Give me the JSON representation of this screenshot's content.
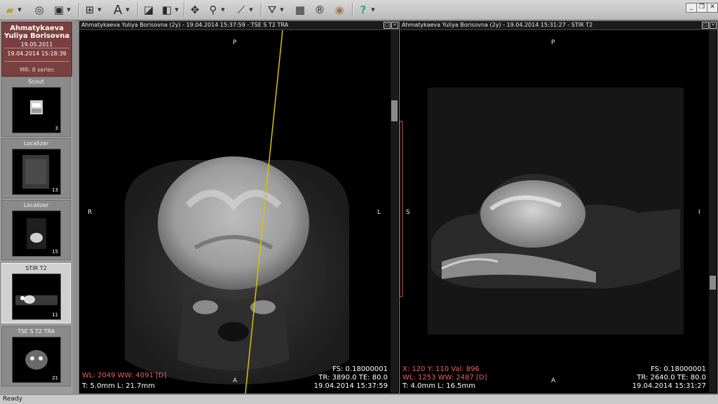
{
  "toolbar": {
    "groups": [
      {
        "icon": "folder-open-icon",
        "glyph": "📂"
      },
      {
        "icon": "cd-disc-icon",
        "glyph": "◎"
      },
      {
        "icon": "save-disk-icon",
        "glyph": "▣"
      },
      {
        "icon": "layout-grid-icon",
        "glyph": "⊞"
      },
      {
        "icon": "text-annotation-icon",
        "glyph": "A"
      },
      {
        "icon": "eraser-icon",
        "glyph": "◪"
      },
      {
        "icon": "window-level-icon",
        "glyph": "◧"
      },
      {
        "icon": "pan-move-icon",
        "glyph": "✥"
      },
      {
        "icon": "zoom-magnifier-icon",
        "glyph": "⚲"
      },
      {
        "icon": "measure-ruler-icon",
        "glyph": "⟋"
      },
      {
        "icon": "crosshair-3d-icon",
        "glyph": "⛛"
      },
      {
        "icon": "film-icon",
        "glyph": "▦"
      },
      {
        "icon": "render-r-icon",
        "glyph": "®"
      },
      {
        "icon": "badge-icon",
        "glyph": "◉"
      },
      {
        "icon": "help-icon",
        "glyph": "?"
      }
    ]
  },
  "patient": {
    "name": "Ahmatykaeva Yuliya Borisovna",
    "dob": "19.05.2011",
    "study_date": "19.04.2014 15:18:39",
    "series_info": "MR: 8 series"
  },
  "series": [
    {
      "label": "Scout",
      "count": "3",
      "active": false
    },
    {
      "label": "Localizer",
      "count": "13",
      "active": false
    },
    {
      "label": "Localizer",
      "count": "15",
      "active": false
    },
    {
      "label": "STIR T2",
      "count": "11",
      "active": true
    },
    {
      "label": "TSE S T2 TRA",
      "count": "21",
      "active": false
    }
  ],
  "viewports": [
    {
      "title": "Ahmatykaeva Yuliya Borisovna (2y) - 19.04.2014 15:37:59 - TSE S T2 TRA",
      "orient": {
        "top": "P",
        "left": "R",
        "right": "L",
        "bottom": "A"
      },
      "bottom_left": [
        "WL: 2049 WW: 4091 [D]",
        "T: 5.0mm L: 21.7mm"
      ],
      "bottom_right": [
        "FS: 0.18000001",
        "TR: 3890.0 TE: 80.0",
        "19.04.2014 15:37:59"
      ]
    },
    {
      "title": "Ahmatykaeva Yuliya Borisovna (2y) - 19.04.2014 15:31:27 - STIR T2",
      "orient": {
        "top": "P",
        "left": "S",
        "right": "I",
        "bottom": "A"
      },
      "bottom_left": [
        "X: 120 Y: 110 Val: 896",
        "WL: 1253 WW: 2487 [D]",
        "T: 4.0mm L: 16.5mm"
      ],
      "bottom_right": [
        "FS: 0.18000001",
        "TR: 2640.0 TE: 80.0",
        "19.04.2014 15:31:27"
      ]
    }
  ],
  "status": "Ready",
  "colors": {
    "patient_bg": "#7a3f3f",
    "overlay_red": "#e86060",
    "reference_line": "#d8c400"
  }
}
